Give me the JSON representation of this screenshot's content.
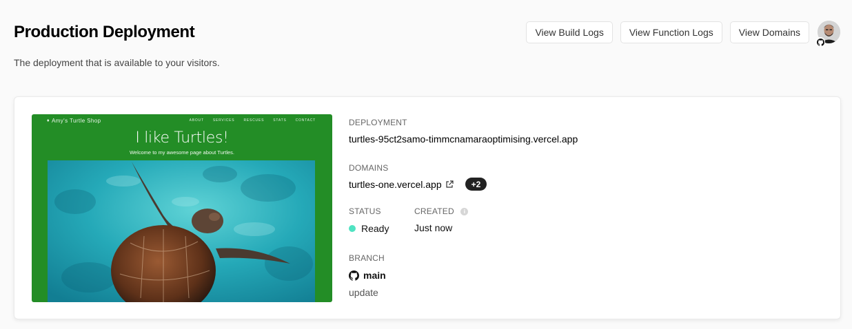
{
  "header": {
    "title": "Production Deployment",
    "subtitle": "The deployment that is available to your visitors."
  },
  "toolbar": {
    "build_logs_label": "View Build Logs",
    "function_logs_label": "View Function Logs",
    "domains_label": "View Domains",
    "avatar_badge_icon": "github-icon"
  },
  "preview": {
    "brand": "Amy's Turtle Shop",
    "nav": [
      "ABOUT",
      "SERVICES",
      "RESCUES",
      "STATS",
      "CONTACT"
    ],
    "heading": "I like Turtles!",
    "subheading": "Welcome to my awesome page about Turtles.",
    "background_color": "#238d26"
  },
  "deployment": {
    "label": "DEPLOYMENT",
    "url": "turtles-95ct2samo-timmcnamaraoptimising.vercel.app"
  },
  "domains": {
    "label": "DOMAINS",
    "primary": "turtles-one.vercel.app",
    "extra_count": "+2",
    "link_icon": "external-link-icon"
  },
  "status": {
    "label": "STATUS",
    "value": "Ready",
    "color": "#50e3c2"
  },
  "created": {
    "label": "CREATED",
    "info_icon": "i",
    "value": "Just now"
  },
  "branch": {
    "label": "BRANCH",
    "name": "main",
    "commit_message": "update",
    "icon": "github-icon"
  }
}
